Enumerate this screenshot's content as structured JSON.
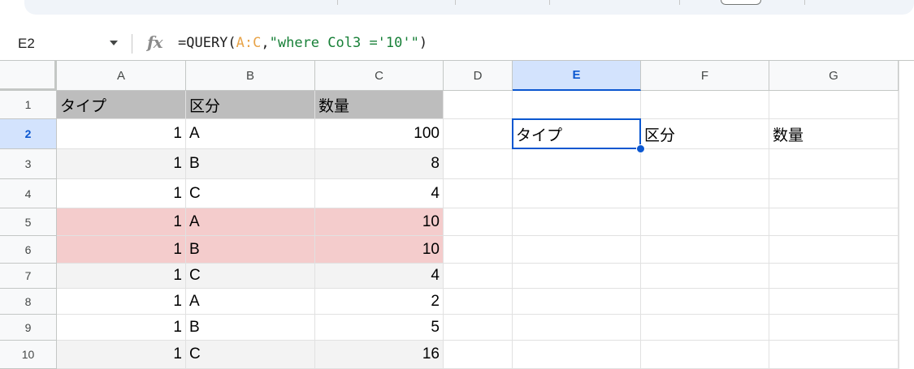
{
  "name_box": {
    "value": "E2"
  },
  "formula_bar": {
    "fx_label": "fx",
    "formula": {
      "prefix": "=QUERY(",
      "range": "A:C",
      "comma": ",",
      "string": "\"where Col3 ='10'\"",
      "suffix": ")"
    }
  },
  "columns": [
    "A",
    "B",
    "C",
    "D",
    "E",
    "F",
    "G"
  ],
  "active_column": "E",
  "rows": [
    "1",
    "2",
    "3",
    "4",
    "5",
    "6",
    "7",
    "8",
    "9",
    "10"
  ],
  "active_row": "2",
  "selected_cell": "E2",
  "colors": {
    "header_fill": "#bdbdbd",
    "band_fill": "#f3f3f3",
    "highlight_fill": "#f4cccc",
    "selection": "#0b57d0"
  },
  "sheet": {
    "A1": "タイプ",
    "B1": "区分",
    "C1": "数量",
    "A2": "1",
    "B2": "A",
    "C2": "100",
    "A3": "1",
    "B3": "B",
    "C3": "8",
    "A4": "1",
    "B4": "C",
    "C4": "4",
    "A5": "1",
    "B5": "A",
    "C5": "10",
    "A6": "1",
    "B6": "B",
    "C6": "10",
    "A7": "1",
    "B7": "C",
    "C7": "4",
    "A8": "1",
    "B8": "A",
    "C8": "2",
    "A9": "1",
    "B9": "B",
    "C9": "5",
    "A10": "1",
    "B10": "C",
    "C10": "16",
    "E2": "タイプ",
    "F2": "区分",
    "G2": "数量"
  }
}
